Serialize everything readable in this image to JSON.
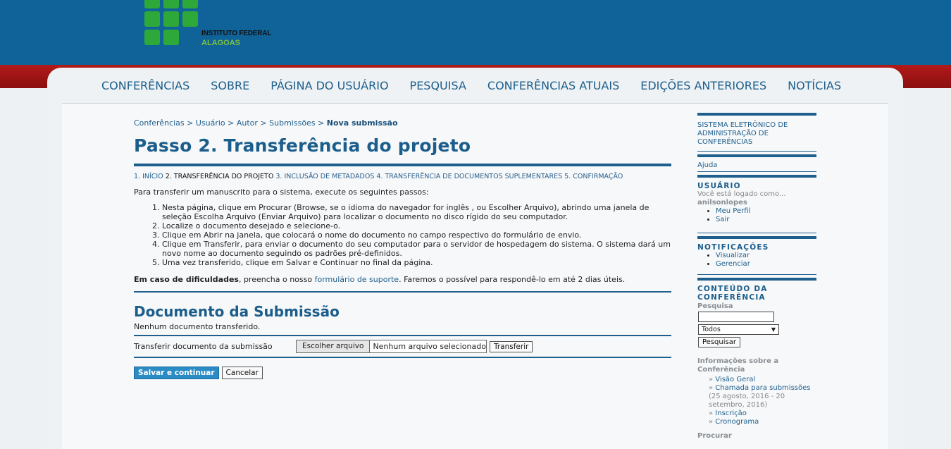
{
  "header": {
    "logo_line1": "INSTITUTO FEDERAL",
    "logo_line2": "ALAGOAS",
    "brand_green": "#2fa83a",
    "brand_blue": "#0f6398",
    "brand_red": "#b21a1a"
  },
  "nav": [
    "CONFERÊNCIAS",
    "SOBRE",
    "PÁGINA DO USUÁRIO",
    "PESQUISA",
    "CONFERÊNCIAS ATUAIS",
    "EDIÇÕES ANTERIORES",
    "NOTÍCIAS"
  ],
  "breadcrumb": {
    "items": [
      "Conferências",
      "Usuário",
      "Autor",
      "Submissões"
    ],
    "current": "Nova submissão",
    "sep": ">"
  },
  "page_title": "Passo 2. Transferência do projeto",
  "steps": [
    {
      "label": "1. INÍCIO",
      "current": false
    },
    {
      "label": "2. TRANSFERÊNCIA DO PROJETO",
      "current": true
    },
    {
      "label": "3. INCLUSÃO DE METADADOS",
      "current": false
    },
    {
      "label": "4. TRANSFERÊNCIA DE DOCUMENTOS SUPLEMENTARES",
      "current": false
    },
    {
      "label": "5. CONFIRMAÇÃO",
      "current": false
    }
  ],
  "intro": "Para transferir um manuscrito para o sistema, execute os seguintes passos:",
  "instructions": [
    "Nesta página, clique em Procurar (Browse, se o idioma do navegador for inglês , ou Escolher Arquivo), abrindo uma janela de seleção Escolha Arquivo (Enviar Arquivo) para localizar o documento no disco rígido do seu computador.",
    "Localize o documento desejado e selecione-o.",
    "Clique em Abrir na janela, que colocará o nome do documento no campo respectivo do formulário de envio.",
    "Clique em Transferir, para enviar o documento do seu computador para o servidor de hospedagem do sistema. O sistema dará um novo nome ao documento seguindo os padrões pré-definidos.",
    "Uma vez transferido, clique em Salvar e Continuar no final da página."
  ],
  "help": {
    "bold": "Em caso de dificuldades",
    "before_link": ", preencha o nosso ",
    "link": "formulário de suporte",
    "after_link": ". Faremos o possível para respondê-lo em até 2 dias úteis."
  },
  "submission": {
    "heading": "Documento da Submissão",
    "none": "Nenhum documento transferido.",
    "field_label": "Transferir documento da submissão",
    "choose_label": "Escolher arquivo",
    "no_file": "Nenhum arquivo selecionado",
    "upload_label": "Transferir"
  },
  "actions": {
    "save": "Salvar e continuar",
    "cancel": "Cancelar"
  },
  "sidebar": {
    "system_link": "SISTEMA ELETRÔNICO DE ADMINISTRAÇÃO DE CONFERÊNCIAS",
    "help": "Ajuda",
    "user_head": "USUÁRIO",
    "logged_as": "Você está logado como...",
    "username": "anilsonlopes",
    "user_links": [
      "Meu Perfil",
      "Sair"
    ],
    "notif_head": "NOTIFICAÇÕES",
    "notif_links": [
      "Visualizar",
      "Gerenciar"
    ],
    "content_head": "CONTEÚDO DA CONFERÊNCIA",
    "search_label": "Pesquisa",
    "search_value": "",
    "scope_selected": "Todos",
    "search_button": "Pesquisar",
    "info_head": "Informações sobre a Conferência",
    "info_links": [
      "Visão Geral",
      "Chamada para submissões"
    ],
    "info_note": "(25 agosto, 2016 - 20 setembro, 2016)",
    "info_links2": [
      "Inscrição",
      "Cronograma"
    ],
    "browse_head": "Procurar"
  }
}
